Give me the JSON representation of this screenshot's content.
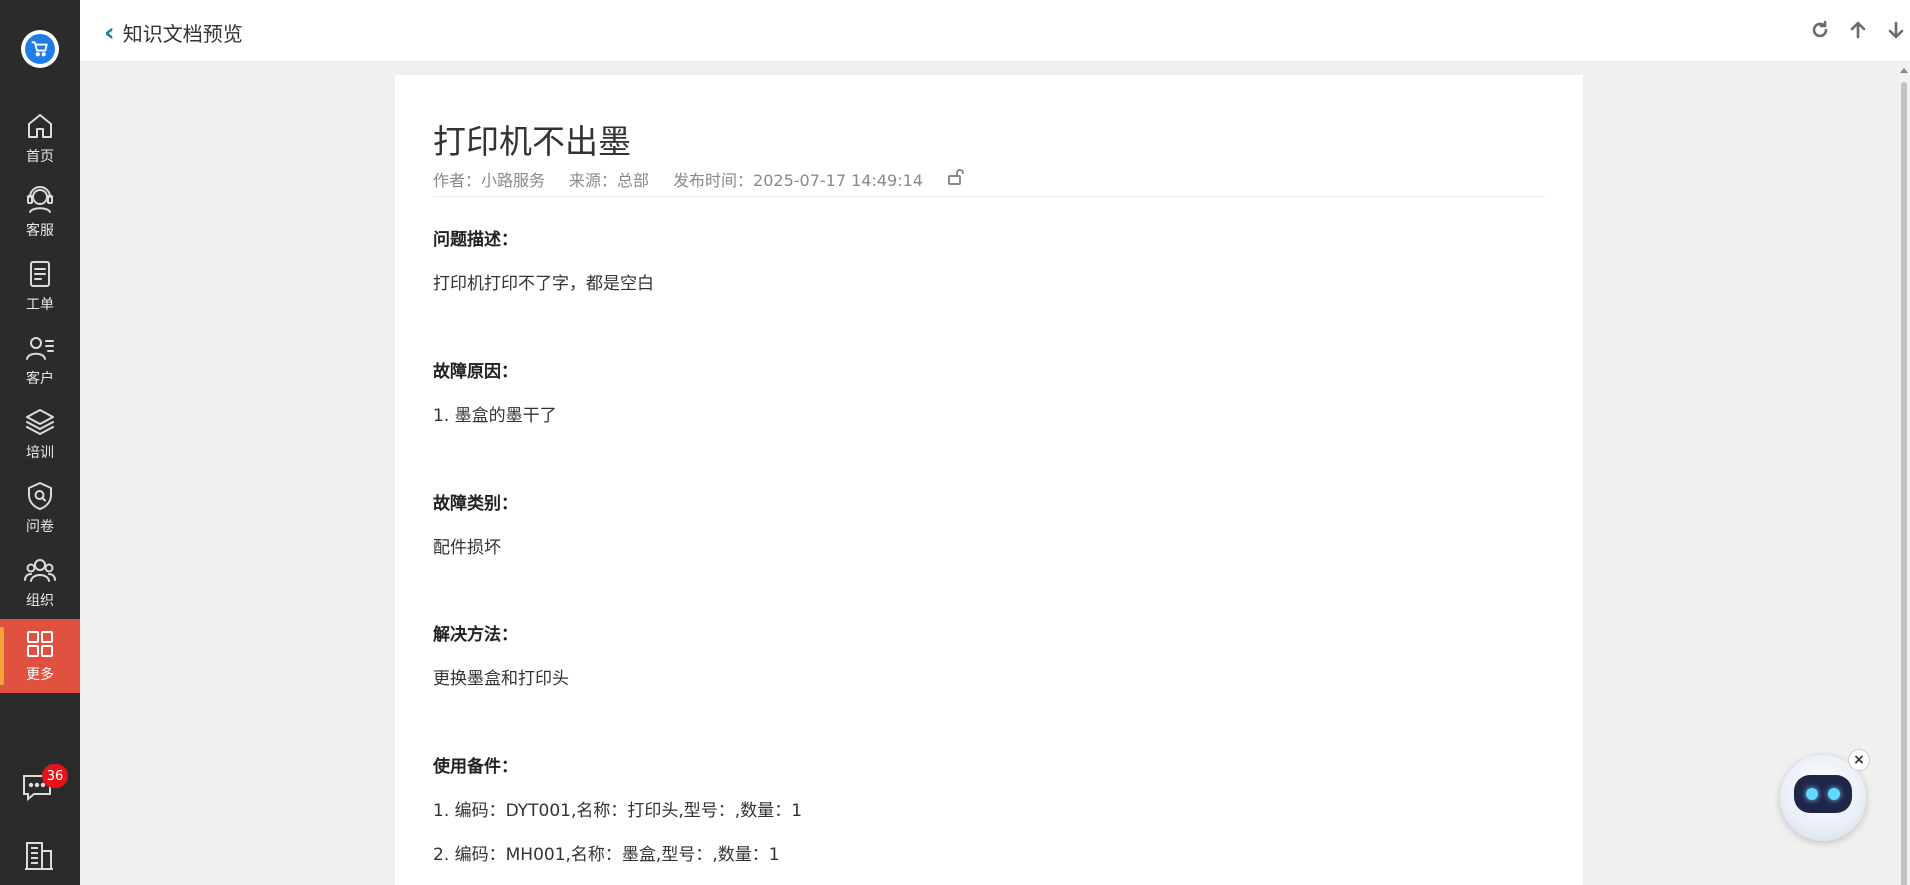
{
  "sidebar": {
    "items": [
      {
        "label": "首页",
        "icon": "home-icon"
      },
      {
        "label": "客服",
        "icon": "headset-icon"
      },
      {
        "label": "工单",
        "icon": "ticket-icon"
      },
      {
        "label": "客户",
        "icon": "customer-icon"
      },
      {
        "label": "培训",
        "icon": "layers-icon"
      },
      {
        "label": "问卷",
        "icon": "shield-search-icon"
      },
      {
        "label": "组织",
        "icon": "group-icon"
      },
      {
        "label": "更多",
        "icon": "grid-icon"
      }
    ],
    "active": "更多",
    "chat_badge": "36",
    "active_color": "#e0523f"
  },
  "header": {
    "back_icon": "chevron-left-icon",
    "title": "知识文档预览",
    "tools": [
      "refresh-icon",
      "arrow-up-icon",
      "arrow-down-icon"
    ]
  },
  "document": {
    "title": "打印机不出墨",
    "meta": {
      "author": "作者：小路服务",
      "source": "来源：总部",
      "published": "发布时间：2025-07-17 14:49:14",
      "lock_icon": "unlock-icon"
    },
    "sections": [
      {
        "heading": "问题描述：",
        "lines": [
          "打印机打印不了字，都是空白"
        ]
      },
      {
        "heading": "故障原因：",
        "lines": [
          "1. 墨盒的墨干了"
        ]
      },
      {
        "heading": "故障类别：",
        "lines": [
          "配件损坏"
        ]
      },
      {
        "heading": "解决方法：",
        "lines": [
          "更换墨盒和打印头"
        ]
      },
      {
        "heading": "使用备件：",
        "lines": [
          "1. 编码：DYT001,名称：打印头,型号：,数量：1",
          "2. 编码：MH001,名称：墨盒,型号：,数量：1"
        ]
      }
    ]
  },
  "assistant": {
    "close_label": "×"
  }
}
